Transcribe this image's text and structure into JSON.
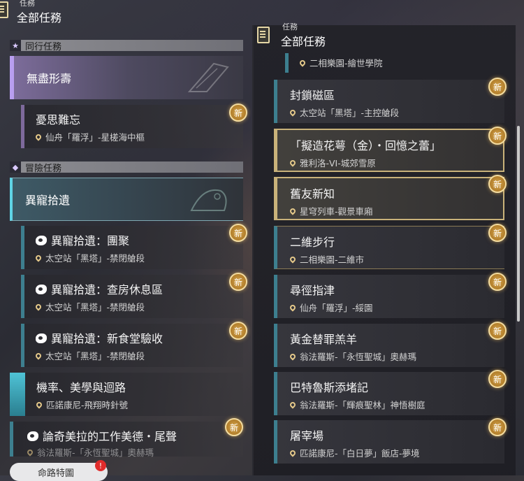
{
  "left_header": {
    "label": "任務",
    "title": "全部任務"
  },
  "right_header": {
    "label": "任務",
    "title": "全部任務"
  },
  "sections": {
    "companion": {
      "title": "同行任務",
      "icon": "star-icon"
    },
    "adventure": {
      "title": "冒險任務",
      "icon": "diamond-icon"
    }
  },
  "left": {
    "category_1": "無盡形壽",
    "category_2": "異寵拾遺",
    "items": [
      {
        "title": "憂思難忘",
        "location": "仙舟「羅浮」-星槎海中樞"
      },
      {
        "title": "異寵拾遺：團聚",
        "location": "太空站「黑塔」-禁閉艙段"
      },
      {
        "title": "異寵拾遺：查房休息區",
        "location": "太空站「黑塔」-禁閉艙段"
      },
      {
        "title": "異寵拾遺：新食堂驗收",
        "location": "太空站「黑塔」-禁閉艙段"
      },
      {
        "title": "機率、美學與迴路",
        "location": "匹諾康尼-飛翔時針號"
      },
      {
        "title": "論奇美拉的工作美德・尾聲",
        "location": "翁法羅斯-「永恆聖城」奧赫瑪"
      }
    ]
  },
  "right": {
    "top_location": "二相樂園-繪世學院",
    "items": [
      {
        "title": "封鎖磁區",
        "location": "太空站「黑塔」-主控艙段"
      },
      {
        "title": "「擬造花萼（金）・回憶之蕾」",
        "location": "雅利洛-VI-城郊雪原"
      },
      {
        "title": "舊友新知",
        "location": "星穹列車-觀景車廂"
      },
      {
        "title": "二維步行",
        "location": "二相樂園-二維市"
      },
      {
        "title": "尋徑指津",
        "location": "仙舟「羅浮」-綏園"
      },
      {
        "title": "黃金替罪羔羊",
        "location": "翁法羅斯-「永恆聖城」奧赫瑪"
      },
      {
        "title": "巴特魯斯添堵記",
        "location": "翁法羅斯-「輝痕聖林」神悟樹庭"
      },
      {
        "title": "屠宰場",
        "location": "匹諾康尼-「白日夢」飯店-夢境"
      }
    ]
  },
  "new_badge": "新",
  "bottom_button": {
    "label": "命路特圖",
    "alert": "!"
  }
}
